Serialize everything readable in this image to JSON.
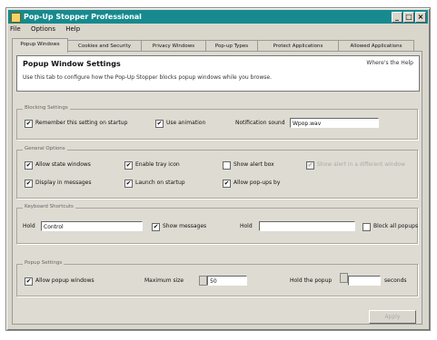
{
  "window": {
    "title": "Pop-Up Stopper Professional"
  },
  "menubar": {
    "items": [
      "File",
      "Options",
      "Help"
    ]
  },
  "tabs": [
    "Popup Windows",
    "Cookies and Security",
    "Privacy Windows",
    "Pop-up Types",
    "Protect Applications",
    "Allowed Applications"
  ],
  "header": {
    "title": "Popup Window Settings",
    "help_link": "Where's the Help",
    "description": "Use this tab to configure how the Pop-Up Stopper blocks popup windows while you browse."
  },
  "groups": {
    "blocking": {
      "label": "Blocking Settings",
      "opt1": {
        "label": "Remember this setting on startup",
        "checked": true
      },
      "opt2": {
        "label": "Use animation",
        "checked": true
      },
      "sound_label": "Notification sound",
      "sound_value": "Wpop.wav"
    },
    "general": {
      "label": "General Options",
      "opts": [
        {
          "label": "Allow state windows",
          "checked": true
        },
        {
          "label": "Enable tray icon",
          "checked": true
        },
        {
          "label": "Show alert box",
          "checked": false
        },
        {
          "label": "Show alert in a different window",
          "checked": true,
          "disabled": true
        },
        {
          "label": "Display in messages",
          "checked": true
        },
        {
          "label": "Launch on startup",
          "checked": true
        },
        {
          "label": "Allow pop-ups by",
          "checked": true
        }
      ]
    },
    "hotkeys": {
      "label": "Keyboard Shortcuts",
      "key1_label": "Hold",
      "key1_value": "Control",
      "opt1": {
        "label": "Show messages",
        "checked": true
      },
      "key2_label": "Hold",
      "key2_value": "",
      "opt2": {
        "label": "Block all popups",
        "checked": false
      }
    },
    "popup": {
      "label": "Popup Settings",
      "opt1": {
        "label": "Allow popup windows",
        "checked": true
      },
      "maxage_label": "Maximum size",
      "maxage_value": "50",
      "sleep_label": "Hold the popup",
      "sleep_value": "",
      "sleep_unit": "seconds"
    }
  },
  "ok_button": "Apply",
  "check_glyph": "✔"
}
